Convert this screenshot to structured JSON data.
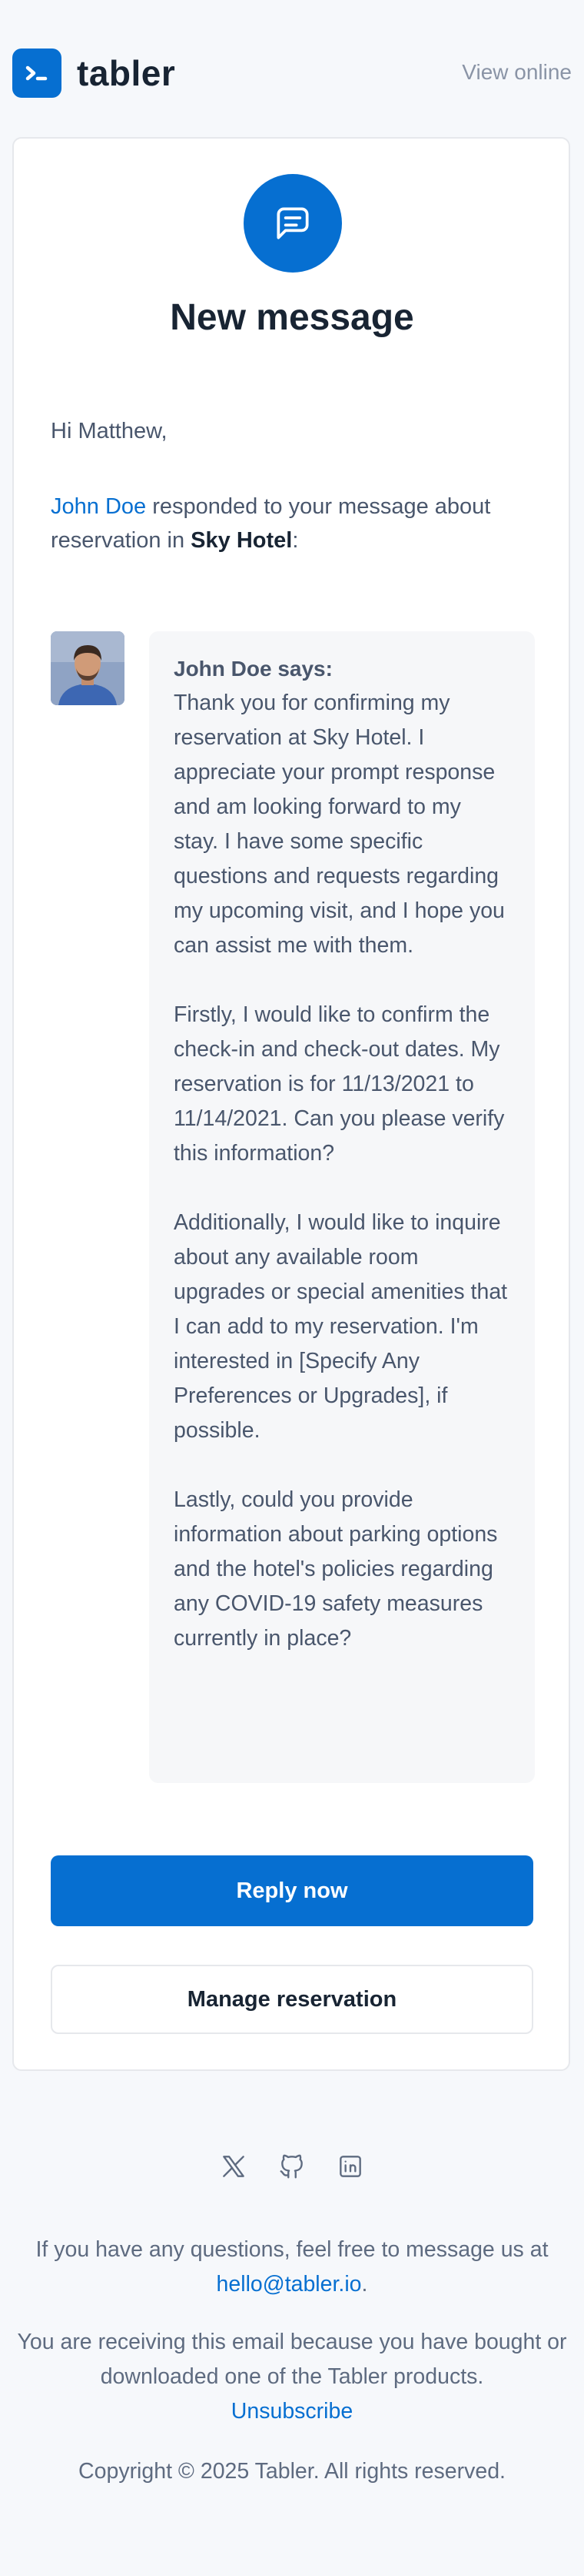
{
  "header": {
    "brand": "tabler",
    "view_online": "View online"
  },
  "card": {
    "title": "New message",
    "greeting": "Hi Matthew,",
    "intro": {
      "sender": "John Doe",
      "text_middle": " responded to your message about reservation in ",
      "hotel": "Sky Hotel",
      "text_end": ":"
    },
    "message": {
      "author_says": "John Doe says:",
      "paragraphs": [
        "Thank you for confirming my reservation at Sky Hotel. I appreciate your prompt response and am looking forward to my stay. I have some specific questions and requests regarding my upcoming visit, and I hope you can assist me with them.",
        "Firstly, I would like to confirm the check-in and check-out dates. My reservation is for 11/13/2021 to 11/14/2021. Can you please verify this information?",
        "Additionally, I would like to inquire about any available room upgrades or special amenities that I can add to my reservation. I'm interested in [Specify Any Preferences or Upgrades], if possible.",
        "Lastly, could you provide information about parking options and the hotel's policies regarding any COVID-19 safety measures currently in place?"
      ]
    },
    "buttons": {
      "reply": "Reply now",
      "manage": "Manage reservation"
    }
  },
  "socials": [
    "x-icon",
    "github-icon",
    "linkedin-icon"
  ],
  "footer": {
    "questions_text": "If you have any questions, feel free to message us at",
    "email": "hello@tabler.io",
    "email_suffix": ".",
    "receiving_text": "You are receiving this email because you have bought or downloaded one of the Tabler products.",
    "unsubscribe": "Unsubscribe",
    "copyright": "Copyright © 2025 Tabler. All rights reserved."
  },
  "colors": {
    "primary": "#066fd1",
    "background": "#f6f8fb",
    "text": "#182433",
    "muted": "#49566c"
  }
}
